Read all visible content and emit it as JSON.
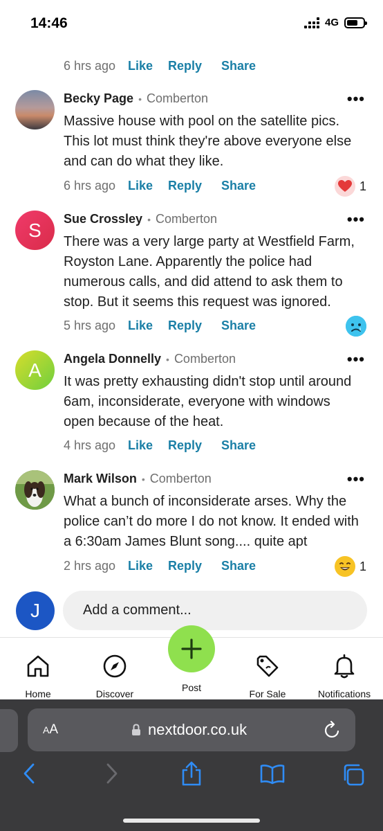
{
  "status_bar": {
    "time": "14:46",
    "network": "4G"
  },
  "top_meta": {
    "time": "6 hrs ago",
    "like": "Like",
    "reply": "Reply",
    "share": "Share"
  },
  "comments": [
    {
      "author": "Becky Page",
      "location": "Comberton",
      "text": "Massive house with pool on the satellite pics. This lot must think they're above everyone else and can do what they like.",
      "time": "6 hrs ago",
      "like": "Like",
      "reply": "Reply",
      "share": "Share",
      "reaction_count": "1"
    },
    {
      "author": "Sue Crossley",
      "initial": "S",
      "location": "Comberton",
      "text": "There was a very large party at Westfield Farm, Royston Lane. Apparently the police had numerous calls, and did attend to ask them to stop. But it seems this request was ignored.",
      "time": "5 hrs ago",
      "like": "Like",
      "reply": "Reply",
      "share": "Share"
    },
    {
      "author": "Angela Donnelly",
      "initial": "A",
      "location": "Comberton",
      "text": "It was pretty exhausting didn't stop until around 6am, inconsiderate, everyone with windows open because of the heat.",
      "time": "4 hrs ago",
      "like": "Like",
      "reply": "Reply",
      "share": "Share"
    },
    {
      "author": "Mark Wilson",
      "location": "Comberton",
      "text": "What a bunch of inconsiderate arses. Why the police can’t do more I do not know. It ended with a 6:30am James Blunt song.... quite apt",
      "time": "2 hrs ago",
      "like": "Like",
      "reply": "Reply",
      "share": "Share",
      "reaction_count": "1"
    }
  ],
  "add_comment": {
    "initial": "J",
    "placeholder": "Add a comment..."
  },
  "nav": {
    "home": "Home",
    "discover": "Discover",
    "post": "Post",
    "for_sale": "For Sale",
    "notifications": "Notifications"
  },
  "browser": {
    "text_size": "AA",
    "url": "nextdoor.co.uk"
  },
  "colors": {
    "link": "#1a7fa6",
    "post_button": "#8fe04e",
    "avatar_j": "#1c56c4"
  },
  "icons": [
    "home-icon",
    "compass-icon",
    "plus-icon",
    "tag-icon",
    "bell-icon",
    "lock-icon",
    "reload-icon",
    "back-icon",
    "forward-icon",
    "share-icon",
    "bookmarks-icon",
    "tabs-icon"
  ]
}
